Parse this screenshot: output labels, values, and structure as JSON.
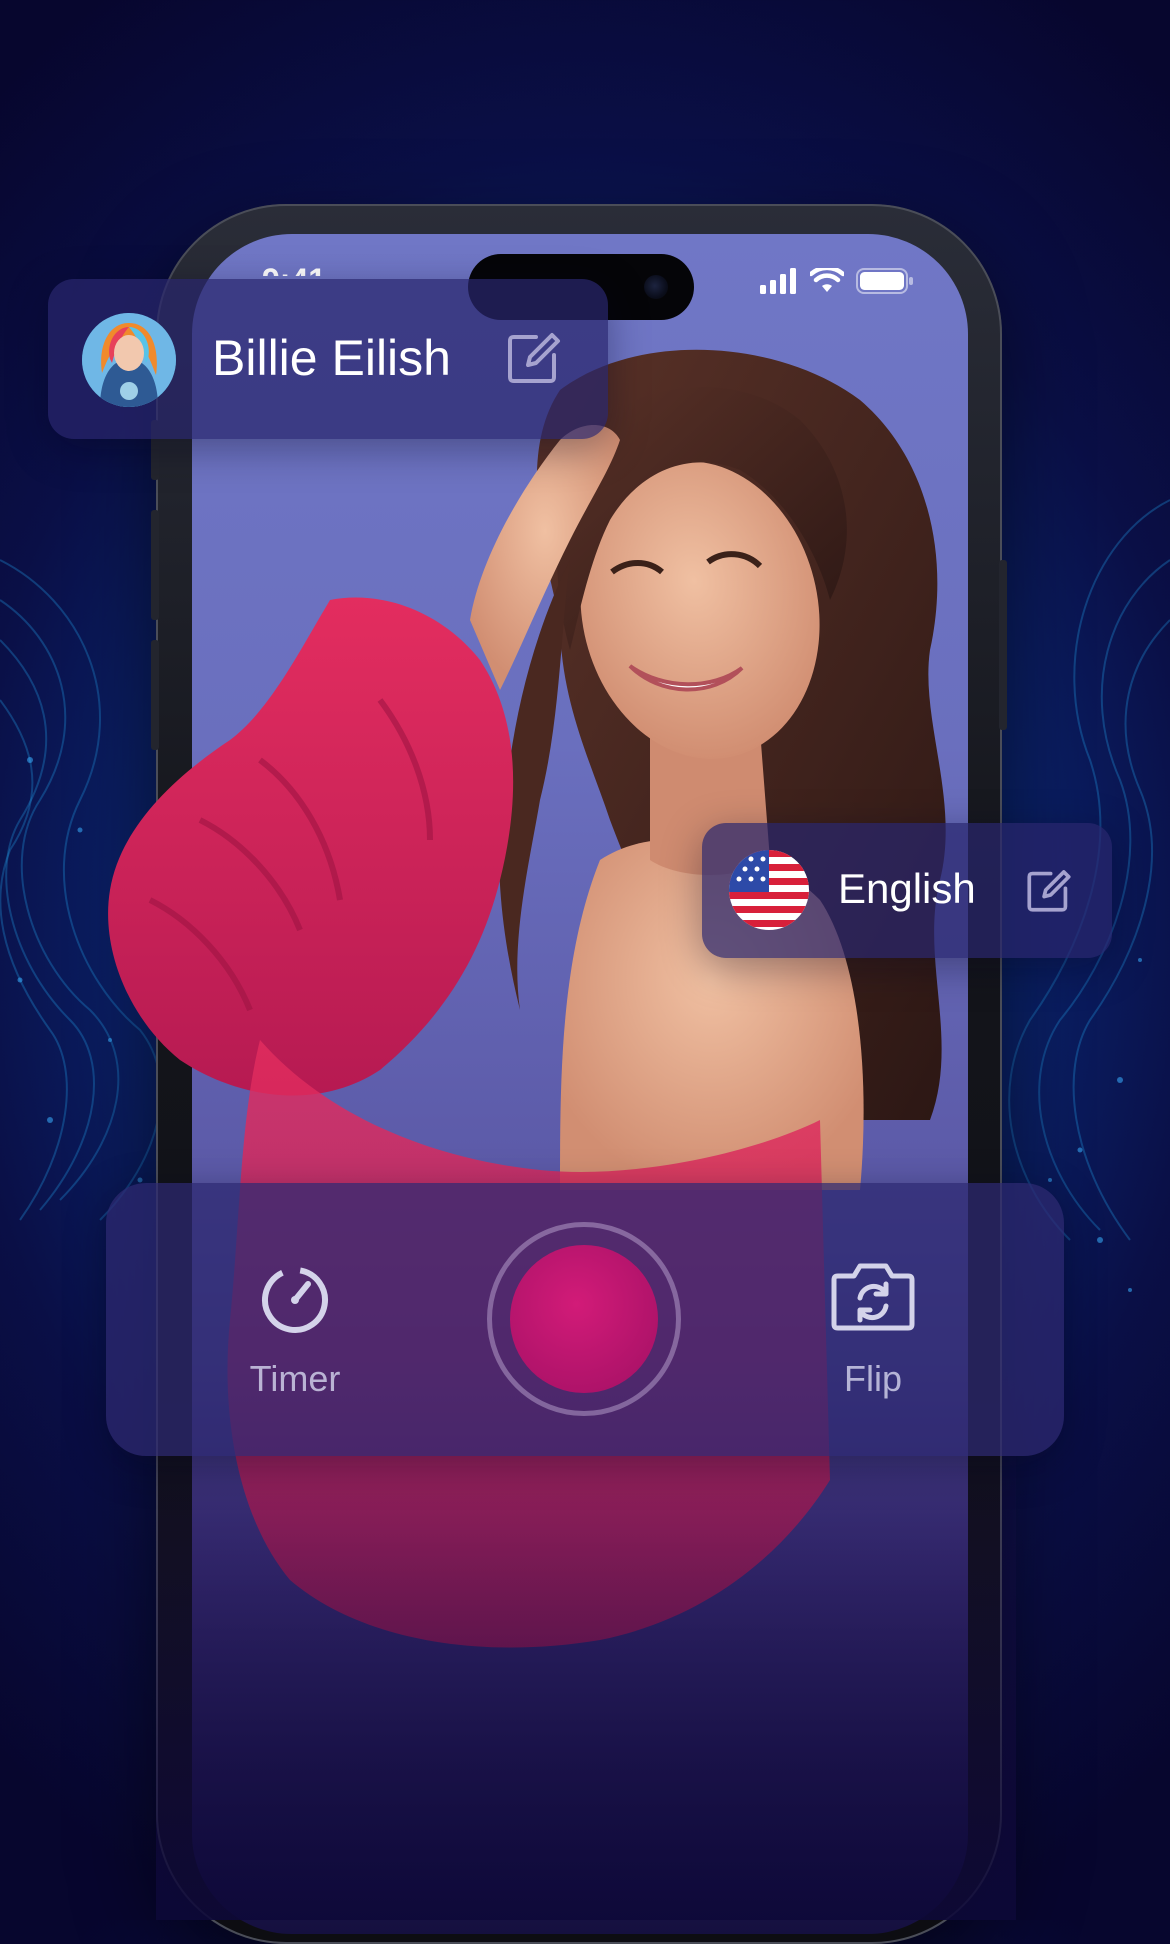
{
  "status_bar": {
    "time": "9:41",
    "icons": [
      "signal-icon",
      "wifi-icon",
      "battery-icon"
    ]
  },
  "profile_card": {
    "name": "Billie Eilish",
    "avatar_icon": "avatar",
    "edit_icon": "edit-icon"
  },
  "language_card": {
    "language": "English",
    "flag_icon": "us-flag-icon",
    "edit_icon": "edit-icon"
  },
  "controls": {
    "timer_label": "Timer",
    "flip_label": "Flip",
    "timer_icon": "timer-icon",
    "flip_icon": "camera-flip-icon",
    "record_icon": "record-button"
  },
  "colors": {
    "background": "#0a2a78",
    "card": "#28266c",
    "record": "#c0166f",
    "dress": "#d8265a"
  }
}
